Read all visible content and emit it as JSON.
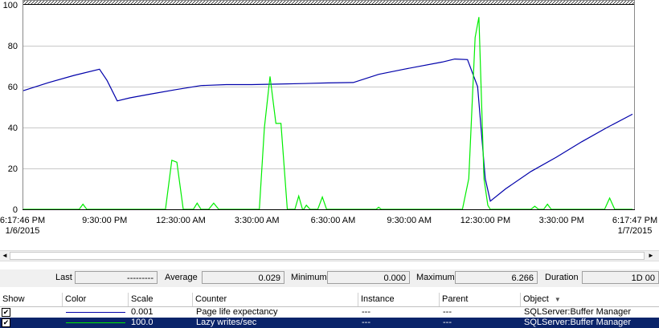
{
  "colors": {
    "page_life": "#0000aa",
    "lazy_writes": "#00ee00",
    "gridline": "#c8c8c8",
    "selected_row": "#0a246a"
  },
  "chart_data": {
    "type": "line",
    "ylim": [
      0,
      100
    ],
    "y_ticks": [
      "0",
      "20",
      "40",
      "60",
      "80",
      "100"
    ],
    "x_range": [
      "2015-01-06 18:17:46",
      "2015-01-07 18:17:47"
    ],
    "x_tick_labels": [
      {
        "t": 0,
        "lines": [
          "6:17:46 PM",
          "1/6/2015"
        ]
      },
      {
        "t": 3.205,
        "lines": [
          "9:30:00 PM"
        ]
      },
      {
        "t": 6.205,
        "lines": [
          "12:30:00 AM"
        ]
      },
      {
        "t": 9.205,
        "lines": [
          "3:30:00 AM"
        ]
      },
      {
        "t": 12.205,
        "lines": [
          "6:30:00 AM"
        ]
      },
      {
        "t": 15.205,
        "lines": [
          "9:30:00 AM"
        ]
      },
      {
        "t": 18.205,
        "lines": [
          "12:30:00 PM"
        ]
      },
      {
        "t": 21.205,
        "lines": [
          "3:30:00 PM"
        ]
      },
      {
        "t": 24,
        "lines": [
          "6:17:47 PM",
          "1/7/2015"
        ]
      }
    ],
    "series": [
      {
        "name": "Page life expectancy",
        "color_key": "page_life",
        "points": [
          [
            0,
            58
          ],
          [
            1,
            62
          ],
          [
            2,
            65.5
          ],
          [
            3.0,
            68.5
          ],
          [
            3.3,
            63
          ],
          [
            3.7,
            53
          ],
          [
            4.2,
            54.5
          ],
          [
            5.0,
            56.3
          ],
          [
            6.0,
            58.5
          ],
          [
            7.0,
            60.5
          ],
          [
            8.0,
            61
          ],
          [
            9.0,
            61
          ],
          [
            10.0,
            61.2
          ],
          [
            11.0,
            61.5
          ],
          [
            12.0,
            61.8
          ],
          [
            13.0,
            62
          ],
          [
            14.0,
            66
          ],
          [
            15.0,
            68.5
          ],
          [
            16.5,
            72
          ],
          [
            17.0,
            73.5
          ],
          [
            17.5,
            73.2
          ],
          [
            17.9,
            60
          ],
          [
            18.2,
            15
          ],
          [
            18.4,
            4
          ],
          [
            19.0,
            10
          ],
          [
            20.0,
            18.5
          ],
          [
            21.0,
            25.5
          ],
          [
            22.0,
            33
          ],
          [
            23.0,
            40
          ],
          [
            24.0,
            46.5
          ]
        ]
      },
      {
        "name": "Lazy writes/sec",
        "color_key": "lazy_writes",
        "points": [
          [
            0,
            0
          ],
          [
            2.2,
            0
          ],
          [
            2.35,
            2.5
          ],
          [
            2.5,
            0
          ],
          [
            5.6,
            0
          ],
          [
            5.85,
            24
          ],
          [
            6.05,
            23
          ],
          [
            6.3,
            0
          ],
          [
            6.7,
            0
          ],
          [
            6.85,
            3
          ],
          [
            7.0,
            0
          ],
          [
            7.3,
            0
          ],
          [
            7.5,
            3
          ],
          [
            7.7,
            0
          ],
          [
            9.3,
            0
          ],
          [
            9.5,
            40
          ],
          [
            9.72,
            65
          ],
          [
            9.95,
            42
          ],
          [
            10.15,
            42
          ],
          [
            10.4,
            0
          ],
          [
            10.7,
            0
          ],
          [
            10.85,
            6.5
          ],
          [
            11.0,
            0
          ],
          [
            11.05,
            0
          ],
          [
            11.15,
            2
          ],
          [
            11.3,
            0
          ],
          [
            11.6,
            0
          ],
          [
            11.78,
            6
          ],
          [
            11.95,
            0
          ],
          [
            13.9,
            0
          ],
          [
            14.0,
            1
          ],
          [
            14.1,
            0
          ],
          [
            17.3,
            0
          ],
          [
            17.55,
            15
          ],
          [
            17.8,
            84
          ],
          [
            17.95,
            94
          ],
          [
            18.15,
            15
          ],
          [
            18.3,
            2
          ],
          [
            18.4,
            0
          ],
          [
            20.0,
            0
          ],
          [
            20.15,
            1.5
          ],
          [
            20.3,
            0
          ],
          [
            20.5,
            0
          ],
          [
            20.65,
            2.5
          ],
          [
            20.8,
            0
          ],
          [
            22.9,
            0
          ],
          [
            23.1,
            5.5
          ],
          [
            23.3,
            0
          ],
          [
            24,
            0
          ]
        ]
      }
    ]
  },
  "scrollbar": {
    "left_arrow": "◄",
    "right_arrow": "►"
  },
  "stats": {
    "last_label": "Last",
    "last_value": "---------",
    "average_label": "Average",
    "average_value": "0.029",
    "minimum_label": "Minimum",
    "minimum_value": "0.000",
    "maximum_label": "Maximum",
    "maximum_value": "6.266",
    "duration_label": "Duration",
    "duration_value": "1D 00"
  },
  "legend": {
    "headers": {
      "show": "Show",
      "color": "Color",
      "scale": "Scale",
      "counter": "Counter",
      "instance": "Instance",
      "parent": "Parent",
      "object": "Object"
    },
    "sort_glyph": "▼",
    "rows": [
      {
        "checked": "✔",
        "scale": "0.001",
        "counter": "Page life expectancy",
        "instance": "---",
        "parent": "---",
        "object": "SQLServer:Buffer Manager"
      },
      {
        "checked": "✔",
        "scale": "100.0",
        "counter": "Lazy writes/sec",
        "instance": "---",
        "parent": "---",
        "object": "SQLServer:Buffer Manager"
      }
    ]
  }
}
